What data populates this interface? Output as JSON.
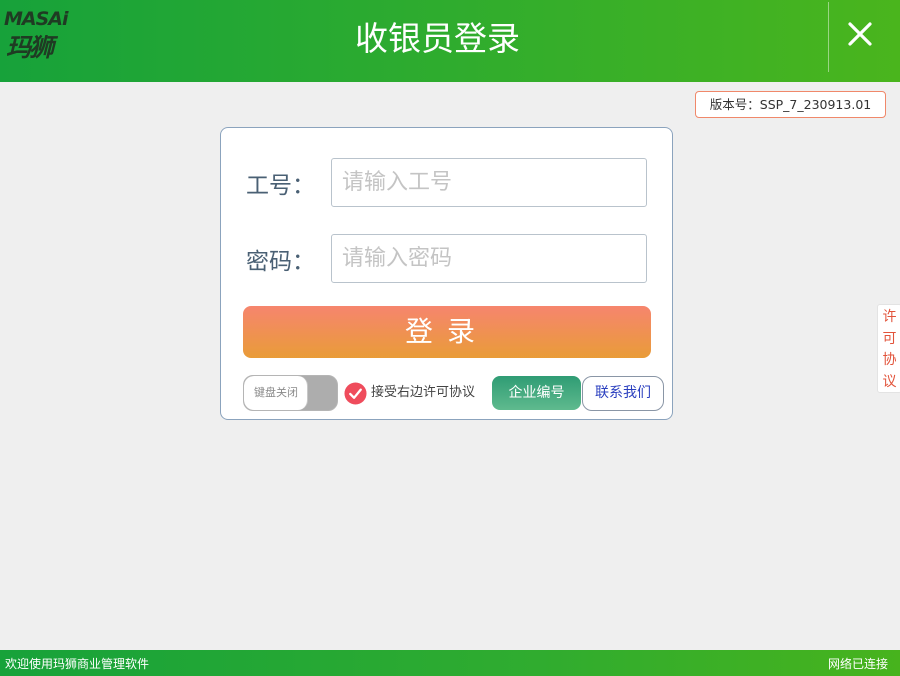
{
  "header": {
    "logo_en": "MASAi",
    "logo_cn": "玛狮",
    "title": "收银员登录"
  },
  "version": {
    "text": "版本号：SSP_7_230913.01"
  },
  "login": {
    "employee_label": "工号：",
    "employee_placeholder": "请输入工号",
    "employee_value": "",
    "password_label": "密码：",
    "password_placeholder": "请输入密码",
    "password_value": "",
    "login_button": "登录",
    "keyboard_toggle": "键盘关闭",
    "agree_text": "接受右边许可协议",
    "agree_checked": true,
    "company_button": "企业编号",
    "contact_button": "联系我们"
  },
  "side_tab": {
    "chars": [
      "许",
      "可",
      "协",
      "议"
    ]
  },
  "status": {
    "left": "欢迎使用玛狮商业管理软件",
    "right": "网络已连接"
  },
  "colors": {
    "header_green": "#2fac2e",
    "login_orange_top": "#f6856e",
    "login_orange_bottom": "#e99c38",
    "company_green": "#3aa57d",
    "check_red": "#ef4c5c",
    "side_tab_text": "#e2533a"
  },
  "icons": {
    "close": "close-x-icon",
    "checkbox": "check-circle-icon"
  }
}
